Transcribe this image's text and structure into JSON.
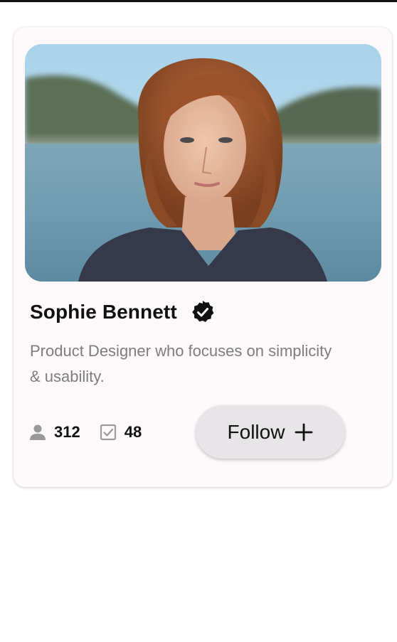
{
  "profile": {
    "name": "Sophie Bennett",
    "bio": "Product Designer who focuses on simplicity & usability.",
    "photo_alt": "Sophie Bennett"
  },
  "stats": {
    "followers": {
      "icon": "person-icon",
      "value": "312"
    },
    "tasks": {
      "icon": "checkbox-icon",
      "value": "48"
    }
  },
  "actions": {
    "follow_label": "Follow",
    "follow_icon": "plus-icon"
  },
  "colors": {
    "card_background": "#fdf9fb",
    "button_background": "#e7e5e7",
    "text_primary": "#111111",
    "text_secondary": "#7d7d7d",
    "icon_muted": "#9a9a9a"
  }
}
